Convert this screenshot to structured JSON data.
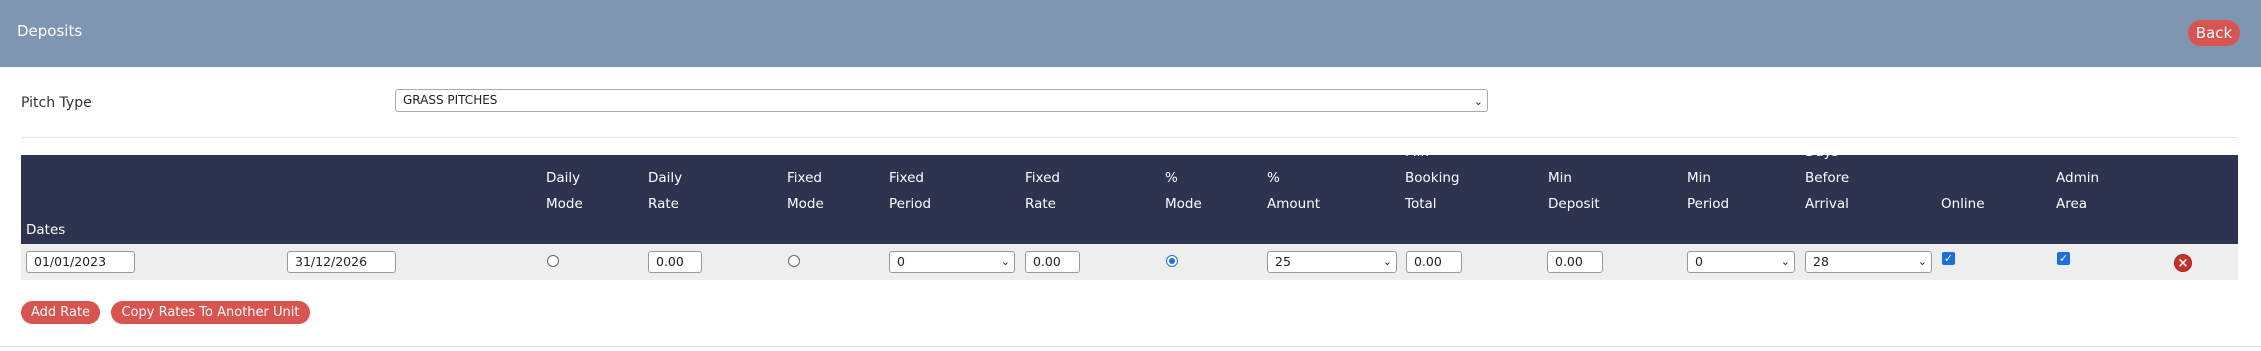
{
  "header": {
    "title": "Deposits",
    "back_label": "Back"
  },
  "pitch": {
    "label": "Pitch Type",
    "value": "GRASS PITCHES"
  },
  "columns": {
    "dates": [
      "Dates"
    ],
    "daily_mode": [
      "Daily",
      "Mode"
    ],
    "daily_rate": [
      "Daily",
      "Rate"
    ],
    "fixed_mode": [
      "Fixed",
      "Mode"
    ],
    "fixed_period": [
      "Fixed",
      "Period"
    ],
    "fixed_rate": [
      "Fixed",
      "Rate"
    ],
    "pct_mode": [
      "%",
      "Mode"
    ],
    "pct_amount": [
      "%",
      "Amount"
    ],
    "min_booking_total": [
      "Min",
      "Booking",
      "Total"
    ],
    "min_deposit": [
      "Min",
      "Deposit"
    ],
    "min_period": [
      "Min",
      "Period"
    ],
    "days_before_arrival": [
      "Days",
      "Before",
      "Arrival"
    ],
    "online": [
      "Online"
    ],
    "admin_area": [
      "Admin",
      "Area"
    ]
  },
  "row": {
    "date_from": "01/01/2023",
    "date_to": "31/12/2026",
    "daily_mode": false,
    "daily_rate": "0.00",
    "fixed_mode": false,
    "fixed_period": "0",
    "fixed_rate": "0.00",
    "pct_mode": true,
    "pct_amount": "25",
    "min_booking_total": "0.00",
    "min_deposit": "0.00",
    "min_period": "0",
    "days_before_arrival": "28",
    "online": true,
    "admin_area": true
  },
  "actions": {
    "add_rate": "Add Rate",
    "copy_rates": "Copy Rates To Another Unit"
  },
  "colors": {
    "header_bg": "#7f96b2",
    "table_head_bg": "#2e3350",
    "button_red": "#d9534f",
    "accent_blue": "#1a6fe0"
  }
}
